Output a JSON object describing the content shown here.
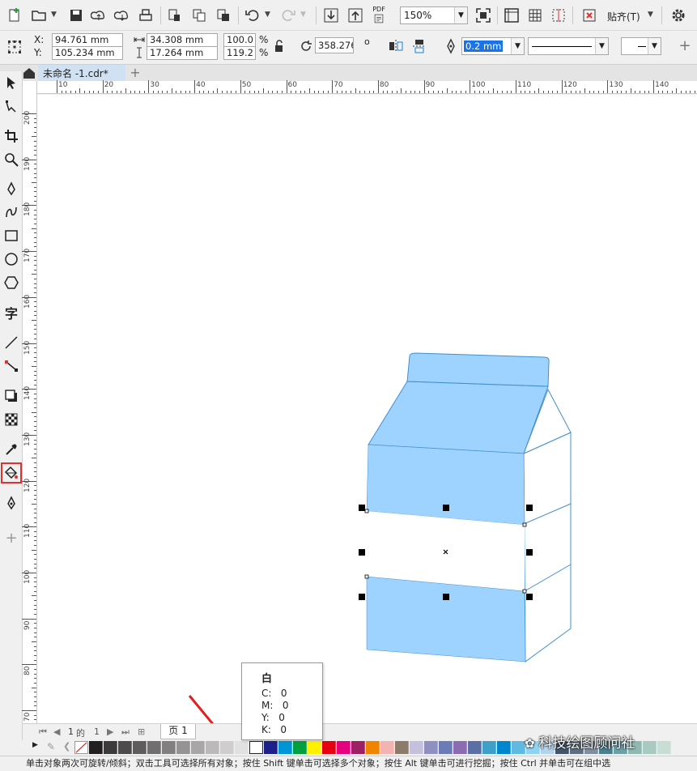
{
  "toolbar": {
    "zoom": "150%",
    "snap_label": "贴齐(T)",
    "pdf_label": "PDF"
  },
  "property_bar": {
    "x_label": "X:",
    "y_label": "Y:",
    "x_value": "94.761 mm",
    "y_value": "105.234 mm",
    "width_value": "34.308 mm",
    "height_value": "17.264 mm",
    "scale_x": "100.0",
    "scale_y": "119.2",
    "percent": "%",
    "rotation": "358.276",
    "degree": "o",
    "outline_width": "0.2 mm"
  },
  "tabs": {
    "document": "未命名 -1.cdr*",
    "add": "+"
  },
  "rulers": {
    "horizontal": [
      "10",
      "20",
      "30",
      "40",
      "50",
      "60",
      "70",
      "80",
      "90",
      "100",
      "110",
      "120",
      "130",
      "140"
    ],
    "vertical": [
      "200",
      "190",
      "180",
      "170",
      "160",
      "150",
      "140",
      "130",
      "120",
      "110",
      "100",
      "90",
      "80",
      "70"
    ]
  },
  "page_nav": {
    "current": "1",
    "of": "的",
    "total": "1",
    "page_tab": "页 1"
  },
  "palette": {
    "colors": [
      "#231f20",
      "#3c3a3a",
      "#4d4b4b",
      "#5e5c5c",
      "#706e6e",
      "#827f7f",
      "#959393",
      "#a8a6a6",
      "#bbb9b9",
      "#cfcdcd",
      "#e2e1e1",
      "#ffffff",
      "#1d2088",
      "#0096d6",
      "#00a040",
      "#fff100",
      "#e60012",
      "#e4007f",
      "#9e1f63",
      "#f08300",
      "#f3b3b3",
      "#8c7a6b",
      "#c4c0dd",
      "#8f8fc0",
      "#6a7bb6",
      "#8c6bb1",
      "#5c6fa5",
      "#3ea0c9",
      "#0086cc",
      "#5fb9e0",
      "#8fd3f0",
      "#b3d4ea",
      "#44546a",
      "#5f7080",
      "#7f8f9f",
      "#4a7f8f",
      "#6fa0a8",
      "#8fb8b0",
      "#aac9c0",
      "#c8ddd4"
    ]
  },
  "tooltip": {
    "title": "白",
    "c": "C:   0",
    "m": "M:   0",
    "y": "Y:   0",
    "k": "K:   0"
  },
  "status": {
    "text": "单击对象两次可旋转/倾斜；双击工具可选择所有对象；按住 Shift 键单击可选择多个对象；按住 Alt 键单击可进行挖掘；按住 Ctrl 并单击可在组中选"
  },
  "watermark": "科技绘图顾问社",
  "colors": {
    "carton_blue": "#9ed2ff",
    "carton_stroke": "#3f8fd0",
    "selection_handle": "#000000",
    "doc_tab": "#cfe1f3",
    "highlight": "#e03030"
  }
}
